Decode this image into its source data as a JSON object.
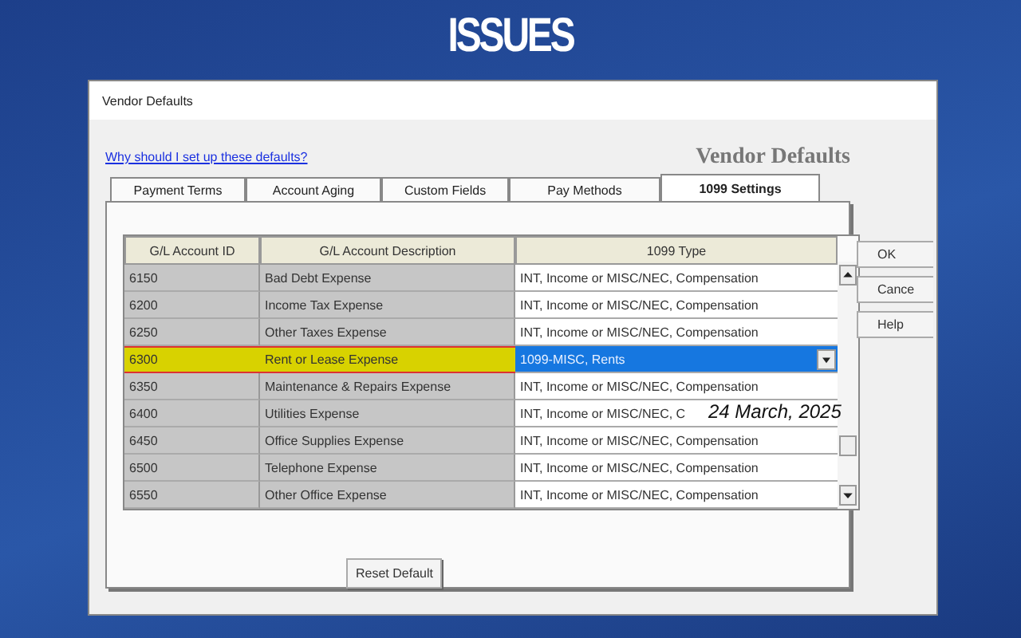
{
  "slide": {
    "title": "ISSUES"
  },
  "window": {
    "title": "Vendor Defaults"
  },
  "help_link": "Why should I set up these defaults?",
  "header": "Vendor Defaults",
  "tabs": [
    {
      "label": "Payment Terms",
      "selected": false
    },
    {
      "label": "Account Aging",
      "selected": false
    },
    {
      "label": "Custom Fields",
      "selected": false
    },
    {
      "label": "Pay Methods",
      "selected": false
    },
    {
      "label": "1099 Settings",
      "selected": true
    }
  ],
  "table": {
    "columns": [
      "G/L Account ID",
      "G/L Account Description",
      "1099 Type"
    ],
    "rows": [
      {
        "id": "6150",
        "description": "Bad Debt Expense",
        "type": "INT, Income or MISC/NEC, Compensation",
        "selected": false
      },
      {
        "id": "6200",
        "description": "Income Tax Expense",
        "type": "INT, Income or MISC/NEC, Compensation",
        "selected": false
      },
      {
        "id": "6250",
        "description": "Other Taxes Expense",
        "type": "INT, Income or MISC/NEC, Compensation",
        "selected": false
      },
      {
        "id": "6300",
        "description": "Rent or Lease Expense",
        "type": "1099-MISC, Rents",
        "selected": true
      },
      {
        "id": "6350",
        "description": "Maintenance & Repairs Expense",
        "type": "INT, Income or MISC/NEC, Compensation",
        "selected": false
      },
      {
        "id": "6400",
        "description": "Utilities Expense",
        "type": "INT, Income or MISC/NEC, C",
        "selected": false
      },
      {
        "id": "6450",
        "description": "Office Supplies Expense",
        "type": "INT, Income or MISC/NEC, Compensation",
        "selected": false
      },
      {
        "id": "6500",
        "description": "Telephone Expense",
        "type": "INT, Income or MISC/NEC, Compensation",
        "selected": false
      },
      {
        "id": "6550",
        "description": "Other Office Expense",
        "type": "INT, Income or MISC/NEC, Compensation",
        "selected": false
      }
    ]
  },
  "reset_button": "Reset Default",
  "side_buttons": [
    "OK",
    "Cance",
    "Help"
  ],
  "annotation": {
    "date": "24 March, 2025"
  }
}
